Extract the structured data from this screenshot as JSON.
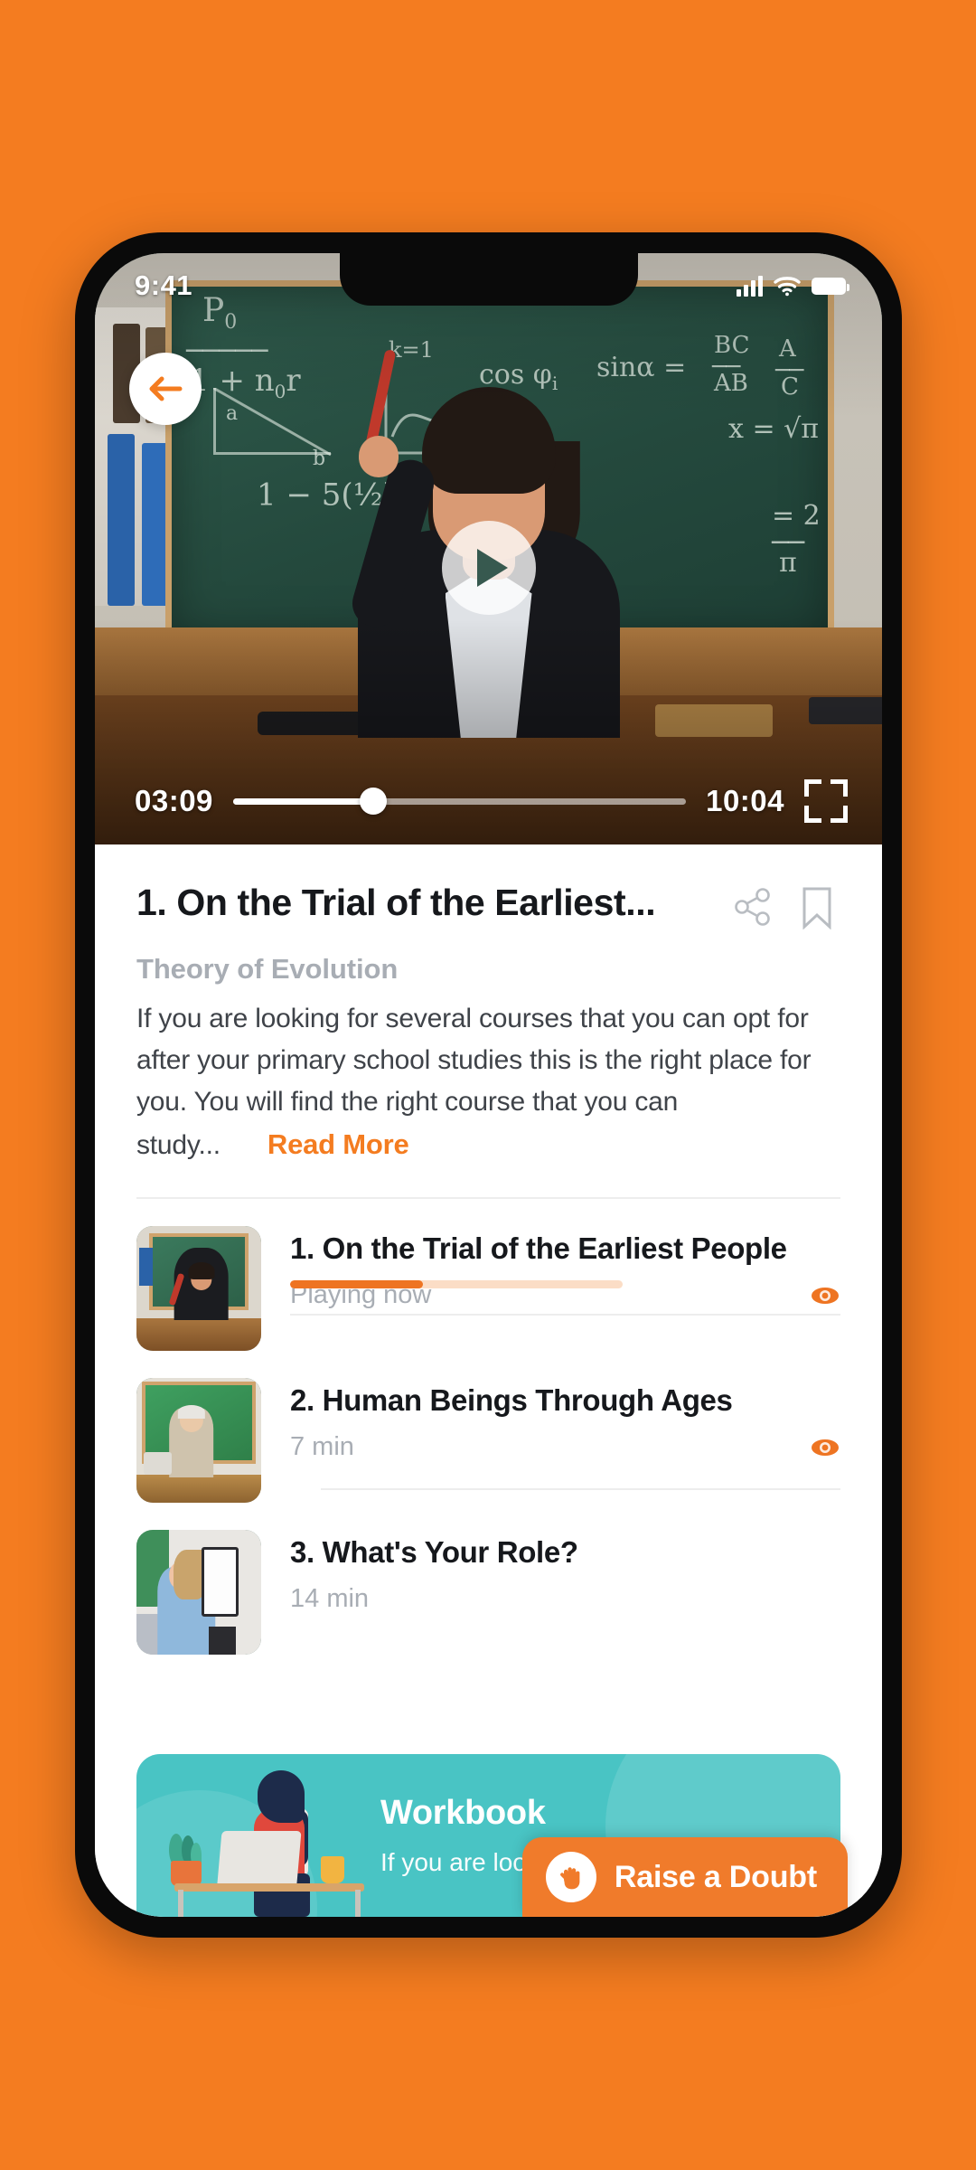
{
  "app": {
    "accent_orange": "#F47C20",
    "accent_teal": "#49C4C4",
    "background": "#F47C20"
  },
  "status_bar": {
    "time": "9:41",
    "signal_icon": "cellular-signal-icon",
    "wifi_icon": "wifi-icon",
    "battery_icon": "battery-icon"
  },
  "video_player": {
    "back_icon": "back-arrow-icon",
    "play_icon": "play-icon",
    "current_time": "03:09",
    "total_time": "10:04",
    "progress_percent": 31,
    "fullscreen_icon": "fullscreen-icon"
  },
  "lesson_header": {
    "title": "1. On the Trial of the Earliest...",
    "share_icon": "share-icon",
    "bookmark_icon": "bookmark-icon",
    "subject": "Theory of Evolution",
    "description": "If you are looking for several courses that you can opt for after your primary school studies this is the right place for you. You will find the right course that you can",
    "description_tail": "study...",
    "read_more_label": "Read More"
  },
  "lessons": [
    {
      "title": "1. On the Trial of the Earliest People",
      "meta": "Playing now",
      "progress_percent": 40,
      "has_progress": true,
      "eye_icon": "eye-icon",
      "thumbnail": "female-teacher-at-chalkboard-thumbnail"
    },
    {
      "title": "2. Human Beings Through Ages",
      "meta": "7 min",
      "progress_percent": 0,
      "has_progress": false,
      "eye_icon": "eye-icon",
      "thumbnail": "older-male-teacher-at-chalkboard-thumbnail"
    },
    {
      "title": "3. What's Your Role?",
      "meta": "14 min",
      "progress_percent": 0,
      "has_progress": false,
      "eye_icon": "",
      "thumbnail": "woman-with-clipboard-thumbnail"
    }
  ],
  "workbook_card": {
    "title": "Workbook",
    "description": "If you are lool",
    "illustration": "woman-working-at-desk-illustration"
  },
  "raise_doubt": {
    "label": "Raise a Doubt",
    "icon": "raised-hand-icon"
  }
}
